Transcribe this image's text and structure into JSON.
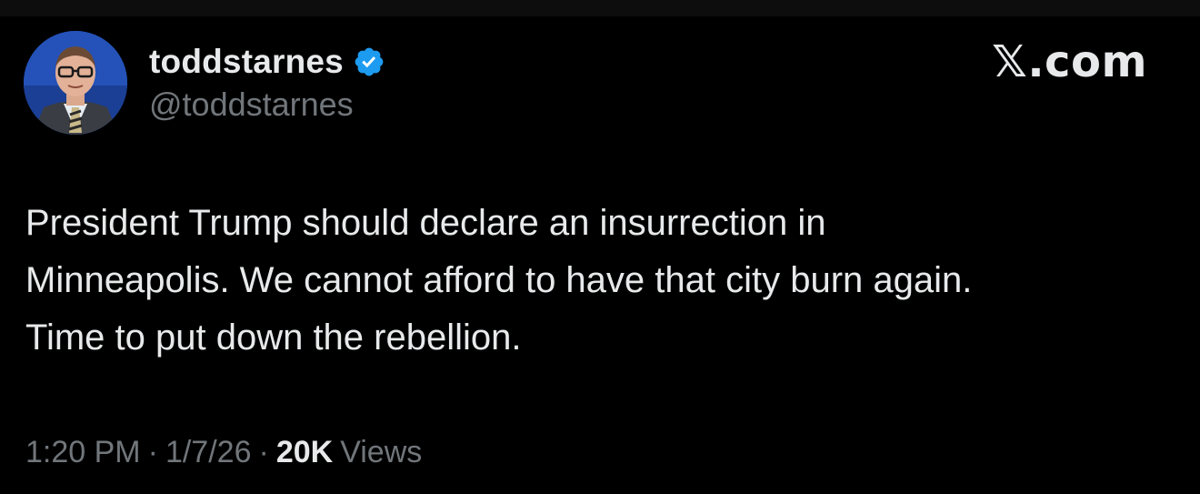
{
  "author": {
    "display_name": "toddstarnes",
    "handle": "@toddstarnes",
    "verified": true,
    "avatar_icon": "profile-photo"
  },
  "brand": {
    "label": "𝕏.com"
  },
  "tweet": {
    "text": "President Trump should declare an insurrection in\nMinneapolis. We cannot afford to have that city burn again.\nTime to put down the rebellion."
  },
  "meta": {
    "time": "1:20 PM",
    "separator": "·",
    "date": "1/7/26",
    "views_count": "20K",
    "views_label": "Views"
  },
  "colors": {
    "background": "#000000",
    "text_primary": "#e7e9ea",
    "text_secondary": "#71767b",
    "verified_blue": "#1d9bf0"
  }
}
